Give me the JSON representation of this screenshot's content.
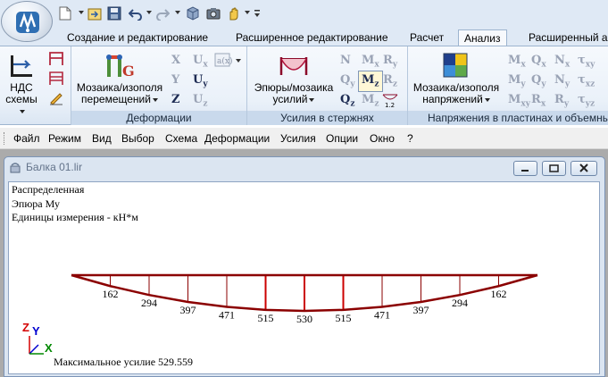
{
  "quick_access": {
    "icons": [
      "new-file-icon",
      "open-file-icon",
      "save-icon",
      "undo-icon",
      "redo-icon",
      "model-3d-icon",
      "camera-icon",
      "hand-icon",
      "customize-icon"
    ]
  },
  "ribbon_tabs": [
    {
      "label": "Создание и редактирование",
      "active": false
    },
    {
      "label": "Расширенное редактирование",
      "active": false
    },
    {
      "label": "Расчет",
      "active": false
    },
    {
      "label": "Анализ",
      "active": true
    },
    {
      "label": "Расширенный ан",
      "active": false
    }
  ],
  "ribbon": {
    "ndc": {
      "line1": "НДС",
      "line2": "схемы"
    },
    "deformations": {
      "title": "Деформации",
      "mosaic_line1": "Мозаика/изополя",
      "mosaic_line2": "перемещений",
      "glyphs": [
        "X",
        "U",
        "Y",
        "U",
        "Z",
        "U"
      ],
      "glyph_subs": [
        "x",
        "y",
        "z"
      ]
    },
    "rod_forces": {
      "title": "Усилия в стержнях",
      "epures_line1": "Эпюры/мозаика",
      "epures_line2": "усилий",
      "glyphs": [
        "N",
        "M",
        "R",
        "Q",
        "M",
        "R",
        "Q",
        "M"
      ],
      "glyph_subs": [
        "x",
        "y",
        "y",
        "z",
        "z",
        "z"
      ],
      "scale_label": "1.2"
    },
    "plate_stress": {
      "title": "Напряжения в пластинах и объемных",
      "mosaic_line1": "Мозаика/изополя",
      "mosaic_line2": "напряжений",
      "glyphs": [
        "M",
        "Q",
        "N",
        "τ",
        "M",
        "Q",
        "N",
        "τ",
        "M",
        "R",
        "R",
        "τ"
      ],
      "glyph_subs": [
        "x",
        "x",
        "x",
        "xy",
        "y",
        "y",
        "y",
        "xz",
        "xy",
        "x",
        "y",
        "yz"
      ]
    }
  },
  "menubar": [
    "Файл",
    "Режим",
    "Вид",
    "Выбор",
    "Схема",
    "Деформации",
    "Усилия",
    "Опции",
    "Окно",
    "?"
  ],
  "window": {
    "title": "Балка 01.lir",
    "info_lines": [
      "Распределенная",
      "Эпюра Му",
      "Единицы измерения - кН*м"
    ],
    "max_label": "Максимальное усилие  529.559",
    "axes": {
      "z": "Z",
      "y": "Y",
      "x": "X"
    }
  },
  "chart_data": {
    "type": "line",
    "title": "Эпюра Му",
    "units": "кН*м",
    "x": [
      1,
      2,
      3,
      4,
      5,
      6,
      7,
      8,
      9,
      10,
      11
    ],
    "values": [
      162,
      294,
      397,
      471,
      515,
      530,
      515,
      471,
      397,
      294,
      162
    ],
    "value_labels": [
      "162",
      "294",
      "397",
      "471",
      "515",
      "530",
      "515",
      "471",
      "397",
      "294",
      "162"
    ],
    "max_value": 529.559,
    "colors": {
      "beam": "#8b0000",
      "epure": "#8b0000",
      "max_ordinate": "#cc0000"
    }
  }
}
